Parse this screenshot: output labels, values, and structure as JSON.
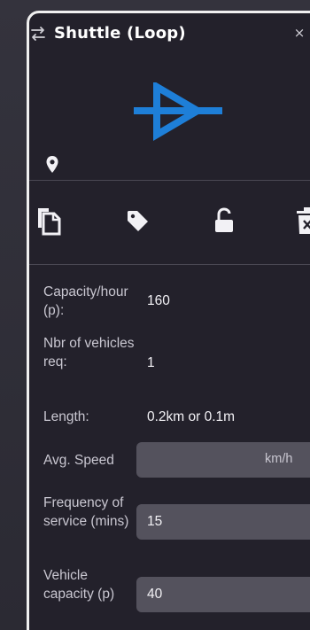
{
  "panel": {
    "title": "Shuttle (Loop)",
    "close_glyph": "×",
    "icons": {
      "swap": "swap-arrows-icon",
      "route_symbol": "shuttle-route-symbol-icon",
      "location": "location-pin-icon",
      "close": "close-icon"
    },
    "colors": {
      "accent": "#1e7fd8",
      "panel_bg": "#23212b",
      "field_bg": "#54525d",
      "border": "#f0f0f0"
    }
  },
  "toolbar": {
    "items": [
      {
        "name": "copy-button",
        "icon": "copy-icon"
      },
      {
        "name": "tag-button",
        "icon": "tag-icon"
      },
      {
        "name": "lock-button",
        "icon": "unlock-icon"
      },
      {
        "name": "delete-button",
        "icon": "trash-icon"
      }
    ]
  },
  "properties": {
    "capacity_hour": {
      "label": "Capacity/hour (p):",
      "value": "160"
    },
    "vehicles_req": {
      "label": "Nbr of vehicles req:",
      "value": "1"
    },
    "length": {
      "label": "Length:",
      "value": "0.2km or 0.1m"
    },
    "avg_speed": {
      "label": "Avg. Speed",
      "value": "",
      "unit": "km/h"
    },
    "frequency": {
      "label": "Frequency of service (mins)",
      "value": "15"
    },
    "vehicle_capacity": {
      "label": "Vehicle capacity (p)",
      "value": "40"
    }
  }
}
